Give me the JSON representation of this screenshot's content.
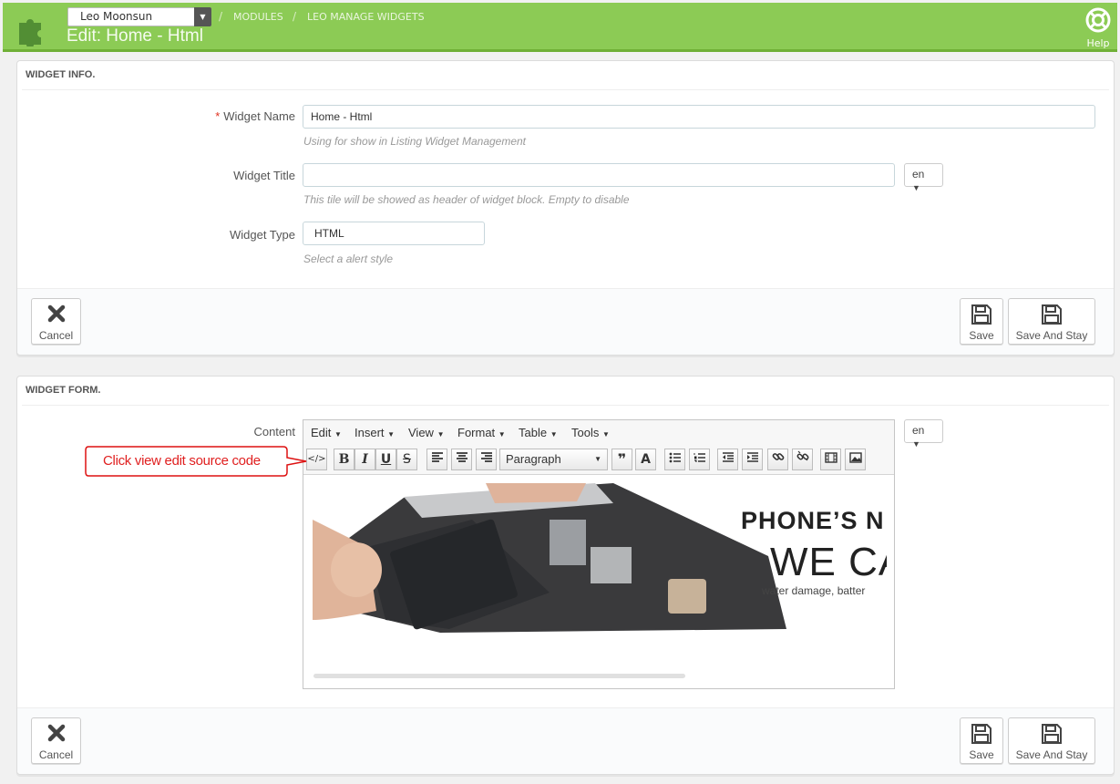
{
  "header": {
    "shop_selector": "Leo Moonsun",
    "breadcrumb": [
      "MODULES",
      "LEO MANAGE WIDGETS"
    ],
    "title": "Edit: Home - Html",
    "help_label": "Help",
    "accent_color": "#8ccb55"
  },
  "widget_info": {
    "heading": "WIDGET INFO.",
    "name_label": "Widget Name",
    "required_mark": "*",
    "name_value": "Home - Html",
    "name_help": "Using for show in Listing Widget Management",
    "title_label": "Widget Title",
    "title_value": "",
    "title_help": "This tile will be showed as header of widget block. Empty to disable",
    "lang": "en",
    "type_label": "Widget Type",
    "type_value": "HTML",
    "type_help": "Select a alert style"
  },
  "widget_form": {
    "heading": "WIDGET FORM.",
    "content_label": "Content",
    "lang": "en",
    "menu": [
      "Edit",
      "Insert",
      "View",
      "Format",
      "Table",
      "Tools"
    ],
    "block_format": "Paragraph",
    "toolbar_icons": [
      "source-code-icon",
      "bold-icon",
      "italic-icon",
      "underline-icon",
      "strikethrough-icon",
      "align-left-icon",
      "align-center-icon",
      "align-right-icon",
      "blockquote-icon",
      "text-color-icon",
      "bullet-list-icon",
      "numbered-list-icon",
      "outdent-icon",
      "indent-icon",
      "link-icon",
      "unlink-icon",
      "media-icon",
      "image-icon"
    ],
    "banner": {
      "line1": "PHONE’S N",
      "line2": "WE CA",
      "line3": "water damage, batter"
    }
  },
  "callout": {
    "text": "Click view edit source code",
    "color": "#e02020"
  },
  "footer": {
    "cancel": "Cancel",
    "save": "Save",
    "save_stay": "Save And Stay"
  }
}
